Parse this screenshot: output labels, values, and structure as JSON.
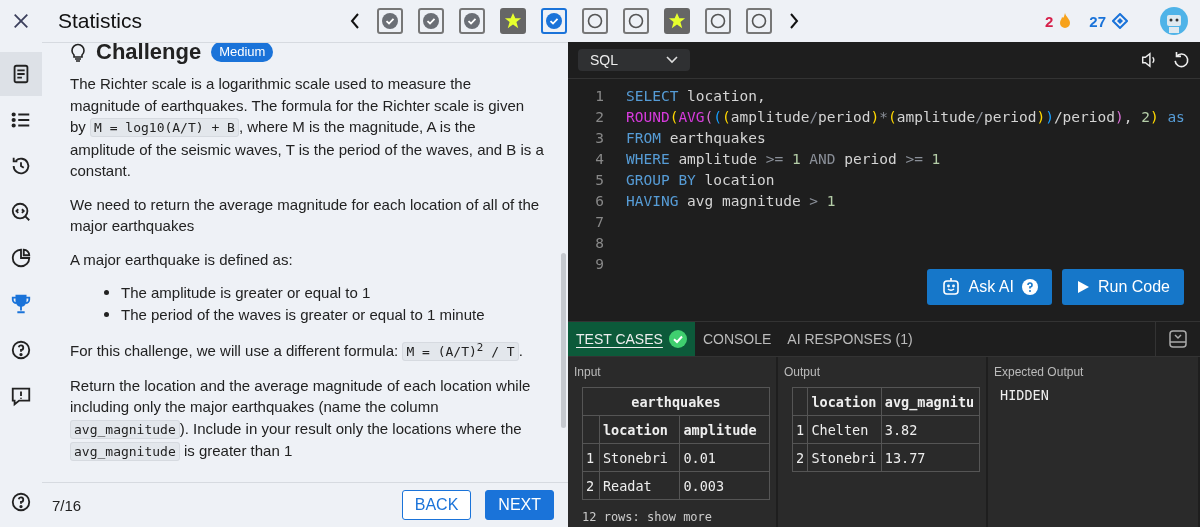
{
  "header": {
    "title": "Statistics",
    "steps": [
      {
        "kind": "done",
        "selected": false
      },
      {
        "kind": "done",
        "selected": false
      },
      {
        "kind": "done",
        "selected": false
      },
      {
        "kind": "star",
        "selected": false
      },
      {
        "kind": "done",
        "selected": true
      },
      {
        "kind": "todo",
        "selected": false
      },
      {
        "kind": "todo",
        "selected": false
      },
      {
        "kind": "star",
        "selected": false
      },
      {
        "kind": "todo",
        "selected": false
      },
      {
        "kind": "todo",
        "selected": false
      }
    ],
    "streak": "2",
    "gems": "27"
  },
  "sidebar": {
    "items": [
      {
        "kind": "document",
        "selected": true
      },
      {
        "kind": "list",
        "selected": false
      },
      {
        "kind": "history",
        "selected": false
      },
      {
        "kind": "search-code",
        "selected": false
      },
      {
        "kind": "chart",
        "selected": false
      },
      {
        "kind": "trophy",
        "selected": false
      },
      {
        "kind": "help",
        "selected": false
      },
      {
        "kind": "report",
        "selected": false
      }
    ]
  },
  "lesson": {
    "title": "Challenge",
    "difficulty": "Medium",
    "blocks": [
      {
        "kind": "para",
        "parts": [
          {
            "text": "The Richter scale is a logarithmic scale used to measure the magnitude of earthquakes. The formula for the Richter scale is given by ",
            "kind": "text"
          },
          {
            "text": "M = log10(A/T) + B",
            "kind": "code"
          },
          {
            "text": ", where M is the magnitude, A is the amplitude of the seismic waves, T is the period of the waves, and B is a constant.",
            "kind": "text"
          }
        ]
      },
      {
        "kind": "para",
        "parts": [
          {
            "text": "We need to return the average magnitude for each location of all of the major earthquakes",
            "kind": "text"
          }
        ]
      },
      {
        "kind": "para",
        "parts": [
          {
            "text": "A major earthquake is defined as:",
            "kind": "text"
          }
        ]
      },
      {
        "kind": "list",
        "items": [
          "The amplitude is greater or equal to 1",
          "The period of the waves is greater or equal to 1 minute"
        ]
      },
      {
        "kind": "para",
        "parts": [
          {
            "text": "For this challenge, we will use a different formula: ",
            "kind": "text"
          },
          {
            "text": "M = (A/T)$^{2}$ / T",
            "kind": "code"
          },
          {
            "text": ".",
            "kind": "text"
          }
        ]
      },
      {
        "kind": "para",
        "parts": [
          {
            "text": "Return the location and the average magnitude of each location while including only the major earthquakes (name the column ",
            "kind": "text"
          },
          {
            "text": "avg_magnitude",
            "kind": "code"
          },
          {
            "text": "). Include in your result only the locations where the ",
            "kind": "text"
          },
          {
            "text": "avg_magnitude",
            "kind": "code"
          },
          {
            "text": " is greater than 1",
            "kind": "text"
          }
        ]
      }
    ],
    "progress": "7/16",
    "back": "BACK",
    "next": "NEXT"
  },
  "editor": {
    "language": "SQL",
    "lines": [
      {
        "number": "1",
        "tokens": [
          {
            "text": "SELECT",
            "kind": "keyword"
          },
          {
            "text": " location,",
            "kind": "name"
          }
        ]
      },
      {
        "number": "2",
        "tokens": [
          {
            "text": "ROUND",
            "kind": "function"
          },
          {
            "text": "(",
            "kind": "bracket"
          },
          {
            "text": "AVG",
            "kind": "function"
          },
          {
            "text": "(",
            "kind": "bracket2"
          },
          {
            "text": "(",
            "kind": "bracket3"
          },
          {
            "text": "(",
            "kind": "bracket"
          },
          {
            "text": "amplitude",
            "kind": "name"
          },
          {
            "text": "/",
            "kind": "operator"
          },
          {
            "text": "period",
            "kind": "name"
          },
          {
            "text": ")",
            "kind": "bracket"
          },
          {
            "text": "*",
            "kind": "operator"
          },
          {
            "text": "(",
            "kind": "bracket"
          },
          {
            "text": "amplitude",
            "kind": "name"
          },
          {
            "text": "/",
            "kind": "operator"
          },
          {
            "text": "period",
            "kind": "name"
          },
          {
            "text": ")",
            "kind": "bracket"
          },
          {
            "text": ")",
            "kind": "bracket3"
          },
          {
            "text": "/period",
            "kind": "name"
          },
          {
            "text": ")",
            "kind": "bracket2"
          },
          {
            "text": ", ",
            "kind": "name"
          },
          {
            "text": "2",
            "kind": "number"
          },
          {
            "text": ")",
            "kind": "bracket"
          },
          {
            "text": " as",
            "kind": "keyword"
          }
        ]
      },
      {
        "number": "3",
        "tokens": [
          {
            "text": "FROM",
            "kind": "keyword"
          },
          {
            "text": " earthquakes",
            "kind": "name"
          }
        ]
      },
      {
        "number": "4",
        "tokens": [
          {
            "text": "WHERE",
            "kind": "keyword"
          },
          {
            "text": " amplitude ",
            "kind": "name"
          },
          {
            "text": ">=",
            "kind": "operator"
          },
          {
            "text": " 1 ",
            "kind": "number"
          },
          {
            "text": "AND",
            "kind": "operator"
          },
          {
            "text": " period ",
            "kind": "name"
          },
          {
            "text": ">=",
            "kind": "operator"
          },
          {
            "text": " 1",
            "kind": "number"
          }
        ]
      },
      {
        "number": "5",
        "tokens": [
          {
            "text": "GROUP BY",
            "kind": "keyword"
          },
          {
            "text": " location",
            "kind": "name"
          }
        ]
      },
      {
        "number": "6",
        "tokens": [
          {
            "text": "HAVING",
            "kind": "keyword"
          },
          {
            "text": " avg_magnitude ",
            "kind": "name"
          },
          {
            "text": ">",
            "kind": "operator"
          },
          {
            "text": " 1",
            "kind": "number"
          }
        ]
      },
      {
        "number": "7"
      },
      {
        "number": "8"
      },
      {
        "number": "9"
      }
    ],
    "ask_ai": "Ask AI",
    "run": "Run Code"
  },
  "results": {
    "tabs": [
      {
        "label": "TEST CASES",
        "selected": true,
        "passed": true
      },
      {
        "label": "CONSOLE",
        "selected": false,
        "passed": false
      },
      {
        "label": "AI RESPONSES (1)",
        "selected": false,
        "passed": false
      }
    ],
    "input": {
      "label": "Input",
      "table": "earthquakes",
      "columns": [
        "location",
        "amplitude"
      ],
      "rows": [
        {
          "index": "1",
          "cells": [
            "Stonebri",
            "0.01"
          ]
        },
        {
          "index": "2",
          "cells": [
            "Readat",
            "0.003"
          ]
        }
      ],
      "more": "12 rows: show more"
    },
    "output": {
      "label": "Output",
      "columns": [
        "location",
        "avg_magnitu"
      ],
      "rows": [
        {
          "index": "1",
          "cells": [
            "Chelten",
            "3.82"
          ]
        },
        {
          "index": "2",
          "cells": [
            "Stonebri",
            "13.77"
          ]
        }
      ]
    },
    "expected": {
      "label": "Expected Output",
      "value": "HIDDEN"
    }
  }
}
